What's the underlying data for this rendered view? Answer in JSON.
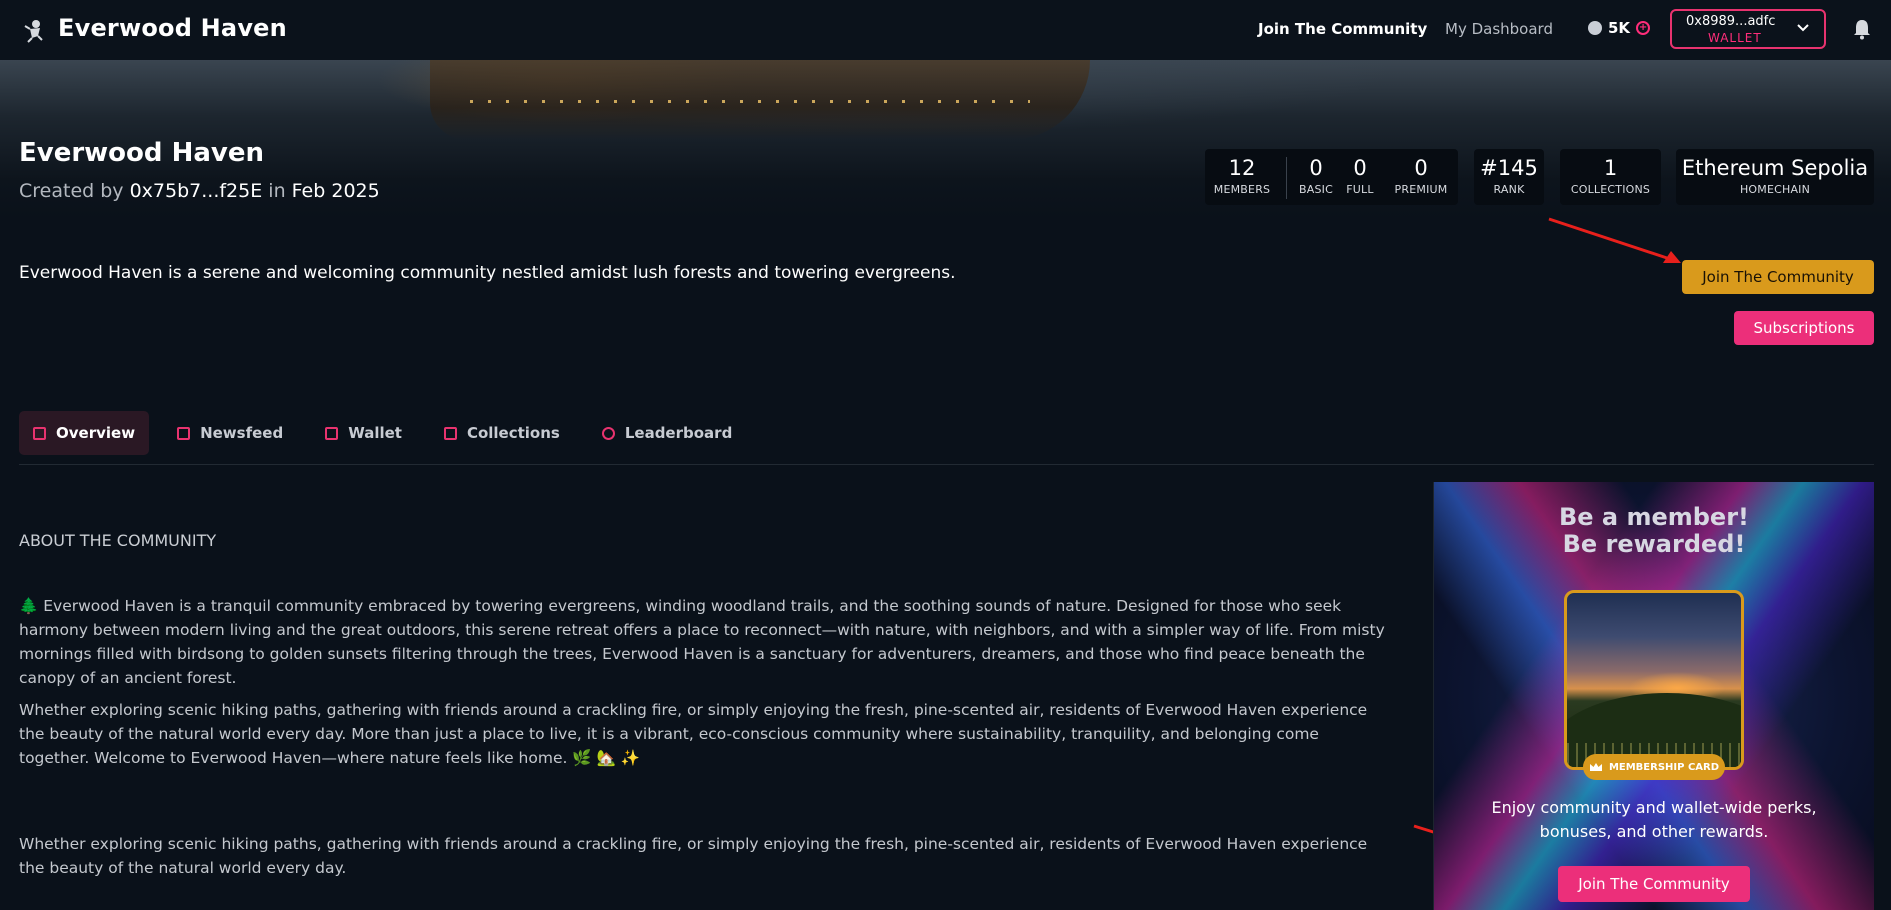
{
  "nav": {
    "brand": "Everwood Haven",
    "join_link": "Join The Community",
    "dashboard_link": "My Dashboard",
    "points": "5K",
    "wallet_address": "0x8989...adfc",
    "wallet_label": "WALLET"
  },
  "hero": {
    "title": "Everwood Haven",
    "created_prefix": "Created by",
    "creator": "0x75b7...f25E",
    "created_in": "in",
    "created_date": "Feb 2025",
    "stats": {
      "members": {
        "value": "12",
        "label": "MEMBERS"
      },
      "basic": {
        "value": "0",
        "label": "BASIC"
      },
      "full": {
        "value": "0",
        "label": "FULL"
      },
      "premium": {
        "value": "0",
        "label": "PREMIUM"
      },
      "rank": {
        "value": "#145",
        "label": "RANK"
      },
      "collections": {
        "value": "1",
        "label": "COLLECTIONS"
      },
      "homechain": {
        "value": "Ethereum Sepolia",
        "label": "HOMECHAIN"
      }
    }
  },
  "description": "Everwood Haven is a serene and welcoming community nestled amidst lush forests and towering evergreens.",
  "actions": {
    "join_label": "Join The Community",
    "subscriptions_label": "Subscriptions"
  },
  "tabs": [
    {
      "label": "Overview",
      "icon": "overview-icon",
      "active": true
    },
    {
      "label": "Newsfeed",
      "icon": "newsfeed-icon",
      "active": false
    },
    {
      "label": "Wallet",
      "icon": "wallet-icon",
      "active": false
    },
    {
      "label": "Collections",
      "icon": "collections-icon",
      "active": false
    },
    {
      "label": "Leaderboard",
      "icon": "leaderboard-icon",
      "active": false
    }
  ],
  "about": {
    "heading": "ABOUT THE COMMUNITY",
    "paragraphs": [
      "🌲 Everwood Haven is a tranquil community embraced by towering evergreens, winding woodland trails, and the soothing sounds of nature. Designed for those who seek harmony between modern living and the great outdoors, this serene retreat offers a place to reconnect—with nature, with neighbors, and with a simpler way of life. From misty mornings filled with birdsong to golden sunsets filtering through the trees, Everwood Haven is a sanctuary for adventurers, dreamers, and those who find peace beneath the canopy of an ancient forest.",
      "Whether exploring scenic hiking paths, gathering with friends around a crackling fire, or simply enjoying the fresh, pine-scented air, residents of Everwood Haven experience the beauty of the natural world every day. More than just a place to live, it is a vibrant, eco-conscious community where sustainability, tranquility, and belonging come together. Welcome to Everwood Haven—where nature feels like home. 🌿 🏡 ✨",
      "Whether exploring scenic hiking paths, gathering with friends around a crackling fire, or simply enjoying the fresh, pine-scented air, residents of Everwood Haven experience the beauty of the natural world every day."
    ]
  },
  "promo": {
    "heading_line1": "Be a member!",
    "heading_line2": "Be rewarded!",
    "badge": "MEMBERSHIP CARD",
    "text": "Enjoy community and wallet-wide perks, bonuses, and other rewards.",
    "button": "Join The Community"
  },
  "colors": {
    "background": "#0a111a",
    "accent_pink": "#ec2f7a",
    "accent_gold": "#d99a1c",
    "annotation_arrow": "#e8201c"
  }
}
